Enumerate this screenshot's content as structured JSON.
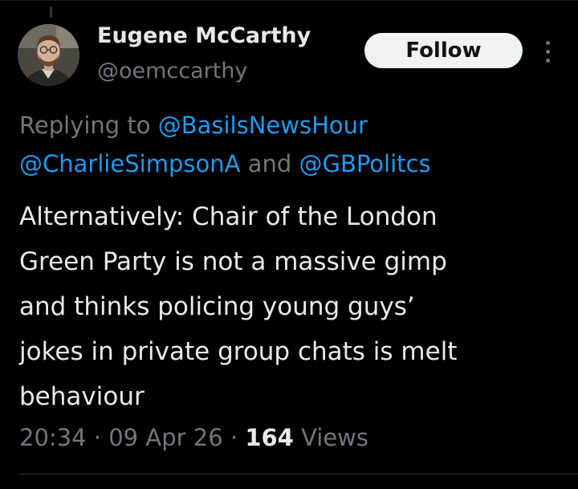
{
  "author": {
    "display_name": "Eugene McCarthy",
    "handle": "@oemccarthy",
    "avatar_icon": "profile-photo"
  },
  "actions": {
    "follow_label": "Follow",
    "more_icon": "vertical-ellipsis-icon"
  },
  "reply_context": {
    "prefix": "Replying to ",
    "mention_1": "@BasilsNewsHour",
    "mention_2": "@CharlieSimpsonA",
    "conjunction": " and ",
    "mention_3": "@GBPolitcs"
  },
  "tweet": {
    "lines": [
      "Alternatively: Chair of the London",
      "Green Party is not a massive gimp",
      "and thinks policing young guys’",
      "jokes in private group chats is melt",
      "behaviour"
    ]
  },
  "meta": {
    "time": "20:34",
    "separator": " · ",
    "date": "09 Apr 26",
    "views_count": "164",
    "views_label": " Views"
  },
  "colors": {
    "background": "#000000",
    "primary_text": "#e7e9ea",
    "secondary_text": "#71767b",
    "link": "#1d9bf0",
    "follow_button_bg": "#eff3f4"
  }
}
